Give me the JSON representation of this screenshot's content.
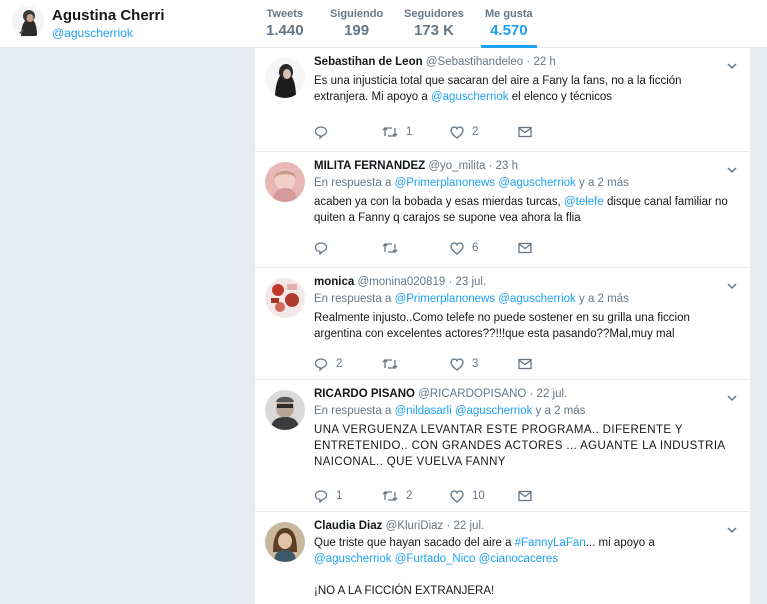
{
  "profile": {
    "name": "Agustina Cherri",
    "handle": "@aguscherriok"
  },
  "stats": [
    {
      "label": "Tweets",
      "value": "1.440"
    },
    {
      "label": "Siguiendo",
      "value": "199"
    },
    {
      "label": "Seguidores",
      "value": "173 K"
    },
    {
      "label": "Me gusta",
      "value": "4.570"
    }
  ],
  "colors": {
    "accent": "#1da1f2",
    "muted": "#657786",
    "background": "#e6ecf0"
  },
  "tweets": [
    {
      "name": "Sebastihan de Leon",
      "handle": "@Sebastihandeleo",
      "time": "· 22 h",
      "text_before": "Es una injusticia total que sacaran del aire a Fany la fans, no a la ficción extranjera. Mi apoyo a ",
      "text_link": "@aguscherriok",
      "text_after": " el elenco y técnicos",
      "reply_count": "",
      "retweet_count": "1",
      "like_count": "2"
    },
    {
      "name": "MILITA FERNANDEZ",
      "handle": "@yo_milita",
      "time": "· 23 h",
      "reply_prefix": "En respuesta a",
      "reply_link1": "@Primerplanonews",
      "reply_link2": "@aguscherriok",
      "reply_suffix": "y a 2 más",
      "text_before": "acaben ya con la bobada y esas mierdas turcas, ",
      "text_link": "@telefe",
      "text_after": " disque canal familiar no quiten a Fanny q carajos se supone vea ahora la flia",
      "reply_count": "",
      "retweet_count": "",
      "like_count": "6"
    },
    {
      "name": "monica",
      "handle": "@monina020819",
      "time": "· 23 jul.",
      "reply_prefix": "En respuesta a",
      "reply_link1": "@Primerplanonews",
      "reply_link2": "@aguscherriok",
      "reply_suffix": "y a 2 más",
      "text": "Realmente injusto..Como telefe no puede sostener en su grilla una ficcion argentina con excelentes actores??!!!que esta pasando??Mal,muy mal",
      "reply_count": "2",
      "retweet_count": "",
      "like_count": "3"
    },
    {
      "name": "RICARDO PISANO",
      "handle": "@RICARDOPISANO",
      "time": "· 22 jul.",
      "reply_prefix": "En respuesta a",
      "reply_link1": "@nildasarli",
      "reply_link2": "@aguscherriok",
      "reply_suffix": "y a 2 más",
      "text": "UNA VERGUENZA LEVANTAR ESTE PROGRAMA.. DIFERENTE Y ENTRETENIDO.. CON GRANDES ACTORES ... AGUANTE LA INDUSTRIA NAICONAL.. QUE VUELVA FANNY",
      "reply_count": "1",
      "retweet_count": "2",
      "like_count": "10"
    },
    {
      "name": "Claudia Diaz",
      "handle": "@KluriDiaz",
      "time": "· 22 jul.",
      "text_before": "Que triste que hayan sacado del aire a ",
      "text_link": "#FannyLaFan",
      "text_after": "... mi apoyo a",
      "mention1": "@aguscherriok",
      "mention2": "@Furtado_Nico",
      "mention3": "@cianocaceres",
      "text_line3": "¡NO A LA FICCIÓN EXTRANJERA!"
    }
  ]
}
